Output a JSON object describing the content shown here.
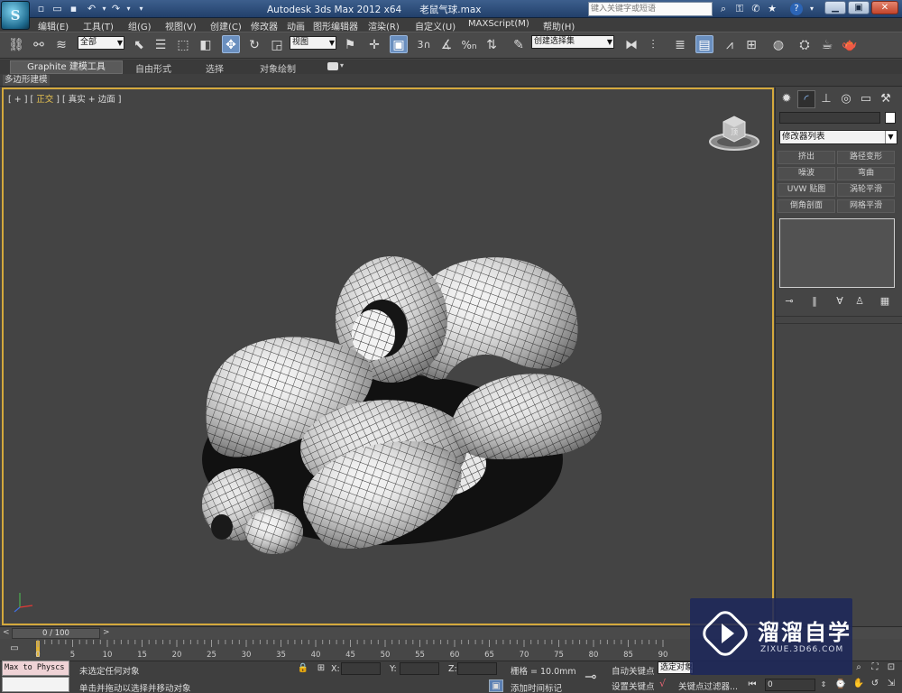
{
  "titlebar": {
    "app_title": "Autodesk 3ds Max  2012 x64",
    "file_name": "老鼠气球.max",
    "search_placeholder": "键入关键字或短语",
    "logo_letter": "S",
    "help_label": "?"
  },
  "menu": [
    "编辑(E)",
    "工具(T)",
    "组(G)",
    "视图(V)",
    "创建(C)",
    "修改器",
    "动画",
    "图形编辑器",
    "渲染(R)",
    "自定义(U)",
    "MAXScript(M)",
    "帮助(H)"
  ],
  "toolbar": {
    "selection_filter": "全部",
    "ref_coord": "视图",
    "named_selection": "创建选择集",
    "snap_3": "3",
    "snap_percent": "%",
    "snap_angle": "n",
    "active_button": "select-move"
  },
  "ribbon": {
    "tabs": [
      "Graphite 建模工具",
      "自由形式",
      "选择",
      "对象绘制"
    ],
    "panel_label": "多边形建模"
  },
  "viewport": {
    "label_plus": "+",
    "label_view": "正交",
    "label_shading": "真实",
    "label_edges": "+ 边面",
    "viewcube_label": "顶",
    "border_color": "#d4a93d"
  },
  "command_panel": {
    "tabs": [
      "create",
      "modify",
      "hierarchy",
      "motion",
      "display",
      "utilities"
    ],
    "active_tab": "modify",
    "modifier_list": "修改器列表",
    "modifier_buttons": [
      "挤出",
      "路径变形",
      "噪波",
      "弯曲",
      "UVW 贴图",
      "涡轮平滑",
      "倒角剖面",
      "网格平滑"
    ]
  },
  "timeline": {
    "slider_text": "0 / 100",
    "ticks": [
      "0",
      "5",
      "10",
      "15",
      "20",
      "25",
      "30",
      "35",
      "40",
      "45",
      "50",
      "55",
      "60",
      "65",
      "70",
      "75",
      "80",
      "85",
      "90"
    ]
  },
  "status": {
    "maxscript_listener": "Max to Physcs (",
    "selection_status": "未选定任何对象",
    "prompt": "单击并拖动以选择并移动对象",
    "x_label": "X:",
    "y_label": "Y:",
    "z_label": "Z:",
    "grid": "栅格 = 10.0mm",
    "add_time_tag": "添加时间标记",
    "auto_key": "自动关键点",
    "set_key": "设置关键点",
    "selected_dropdown": "选定对象",
    "key_filters": "关键点过滤器...",
    "frame_value": "0"
  },
  "watermark": {
    "brand_cn": "溜溜自学",
    "brand_en": "ZIXUE.3D66.COM"
  }
}
